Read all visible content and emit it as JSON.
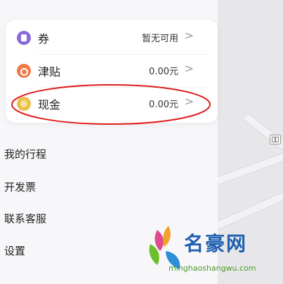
{
  "wallet": {
    "rows": [
      {
        "icon": "coupon-icon",
        "label": "券",
        "value": "暂无可用"
      },
      {
        "icon": "subsidy-icon",
        "label": "津贴",
        "value": "0.00元"
      },
      {
        "icon": "cash-coin-icon",
        "label": "现金",
        "value": "0.00元"
      }
    ],
    "chevron": ">"
  },
  "menu": {
    "items": [
      "我的行程",
      "开发票",
      "联系客服",
      "设置"
    ]
  },
  "watermark": {
    "title": "名豪网",
    "url": "minghaoshangwu.com"
  },
  "colors": {
    "highlight_ellipse": "#e01b1b",
    "coupon_icon": "#8b6bd9",
    "subsidy_icon": "#ef7a47",
    "cash_icon": "#e9c14b",
    "map_background": "#e7e7e9"
  }
}
